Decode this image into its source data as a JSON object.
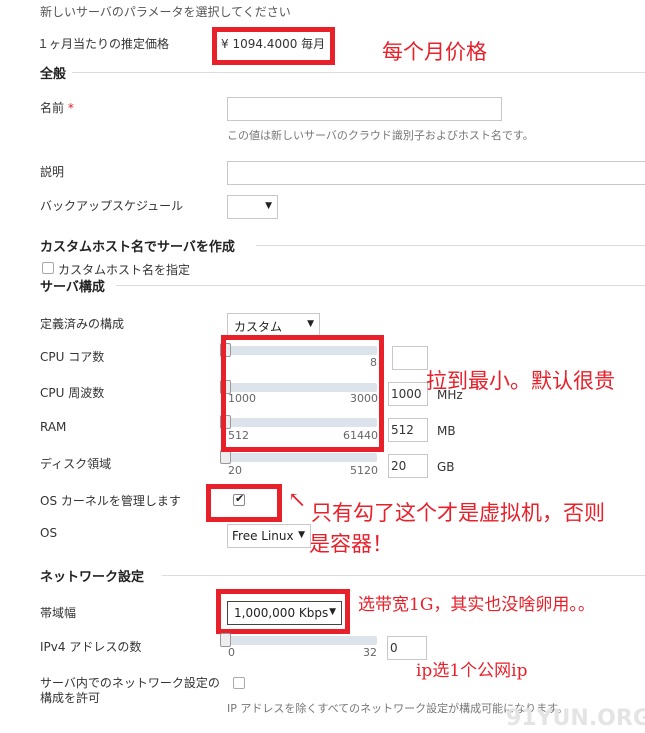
{
  "intro": "新しいサーバのパラメータを選択してください",
  "price": {
    "label": "１ヶ月当たりの推定価格",
    "value": "¥ 1094.4000 毎月"
  },
  "general": {
    "title": "全般",
    "name_label": "名前",
    "required_mark": "*",
    "name_value": "",
    "name_hint": "この値は新しいサーバのクラウド識別子およびホスト名です。",
    "desc_label": "説明",
    "desc_value": "",
    "backup_label": "バックアップスケジュール",
    "backup_value": ""
  },
  "custom_host": {
    "title": "カスタムホスト名でサーバを作成",
    "checkbox_label": "カスタムホスト名を指定"
  },
  "server": {
    "title": "サーバ構成",
    "preset_label": "定義済みの構成",
    "preset_value": "カスタム",
    "cpu_cores": {
      "label": "CPU コア数",
      "min": "",
      "max": "8",
      "value": ""
    },
    "cpu_freq": {
      "label": "CPU 周波数",
      "min": "1000",
      "max": "3000",
      "value": "1000",
      "unit": "MHz"
    },
    "ram": {
      "label": "RAM",
      "min": "512",
      "max": "61440",
      "value": "512",
      "unit": "MB"
    },
    "disk": {
      "label": "ディスク領域",
      "min": "20",
      "max": "5120",
      "value": "20",
      "unit": "GB"
    },
    "kernel_label": "OS カーネルを管理します",
    "os_label": "OS",
    "os_value": "Free Linux"
  },
  "network": {
    "title": "ネットワーク設定",
    "bandwidth_label": "帯域幅",
    "bandwidth_value": "1,000,000 Kbps",
    "ipv4_label": "IPv4 アドレスの数",
    "ipv4_min": "0",
    "ipv4_max": "32",
    "ipv4_value": "0",
    "allow_label_1": "サーバ内でのネットワーク設定の",
    "allow_label_2": "構成を許可",
    "allow_hint": "IP アドレスを除くすべてのネットワーク設定が構成可能になります。"
  },
  "annotations": {
    "monthly_price": "每个月价格",
    "drag_min": "拉到最小。默认很贵",
    "vm_note_1": "只有勾了这个才是虚拟机，否则",
    "vm_note_2": "是容器！",
    "bandwidth_note": "选带宽1G，其实也没啥卵用。。",
    "ip_note": "ip选1个公网ip"
  },
  "watermark": "91YUN.ORG",
  "colors": {
    "annotation_red": "#e8202a"
  }
}
